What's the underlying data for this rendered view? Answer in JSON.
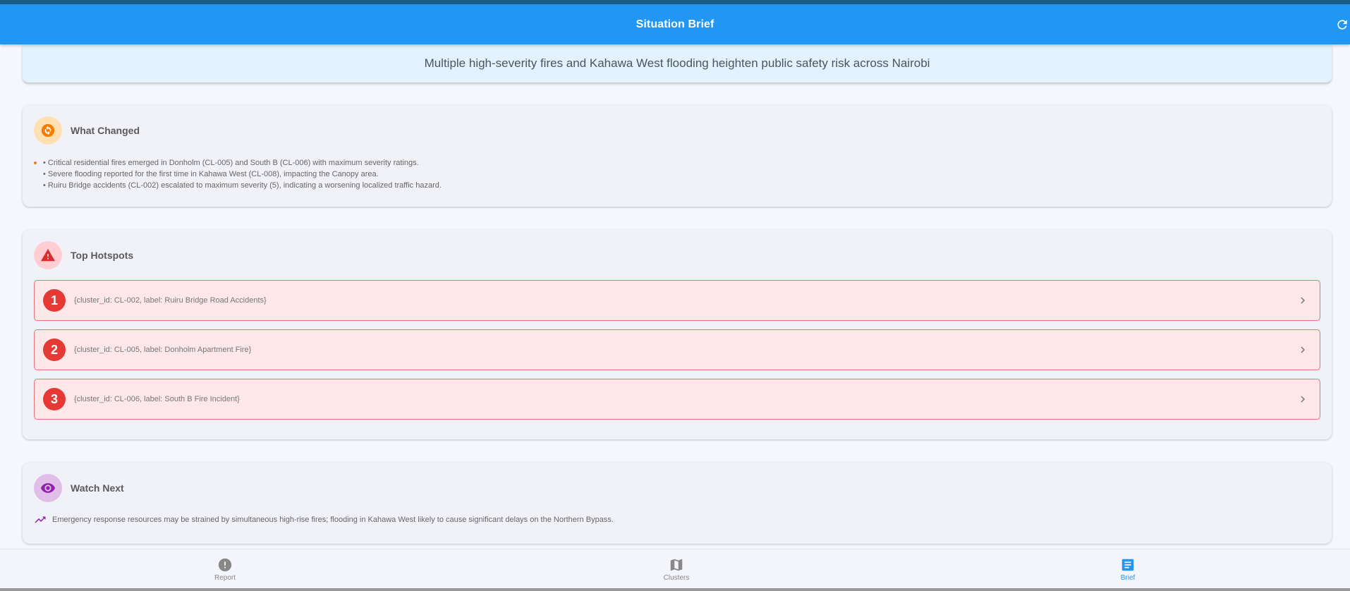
{
  "appbar": {
    "title": "Situation Brief",
    "color": "#2196f3",
    "refresh_icon": "refresh-icon"
  },
  "headline": "Multiple high-severity fires and Kahawa West flooding heighten public safety risk across Nairobi",
  "what_changed": {
    "title": "What Changed",
    "icon": "sync-icon",
    "accent": "#f57c00",
    "items": [
      "• Critical residential fires emerged in Donholm (CL-005) and South B (CL-006) with maximum severity ratings.",
      "• Severe flooding reported for the first time in Kahawa West (CL-008), impacting the Canopy area.",
      "• Ruiru Bridge accidents (CL-002) escalated to maximum severity (5), indicating a worsening localized traffic hazard."
    ]
  },
  "top_hotspots": {
    "title": "Top Hotspots",
    "icon": "warning-icon",
    "accent": "#d32f2f",
    "items": [
      {
        "rank": "1",
        "label": "{cluster_id: CL-002, label: Ruiru Bridge Road Accidents}"
      },
      {
        "rank": "2",
        "label": "{cluster_id: CL-005, label: Donholm Apartment Fire}"
      },
      {
        "rank": "3",
        "label": "{cluster_id: CL-006, label: South B Fire Incident}"
      }
    ]
  },
  "watch_next": {
    "title": "Watch Next",
    "icon": "eye-icon",
    "accent": "#8e24aa",
    "trend_icon": "trending-up-icon",
    "text": "Emergency response resources may be strained by simultaneous high-rise fires; flooding in Kahawa West likely to cause significant delays on the Northern Bypass."
  },
  "bottom_nav": {
    "items": [
      {
        "label": "Report",
        "icon": "alert-circle-icon",
        "active": false
      },
      {
        "label": "Clusters",
        "icon": "map-icon",
        "active": false
      },
      {
        "label": "Brief",
        "icon": "article-icon",
        "active": true
      }
    ],
    "active_color": "#2196f3"
  }
}
